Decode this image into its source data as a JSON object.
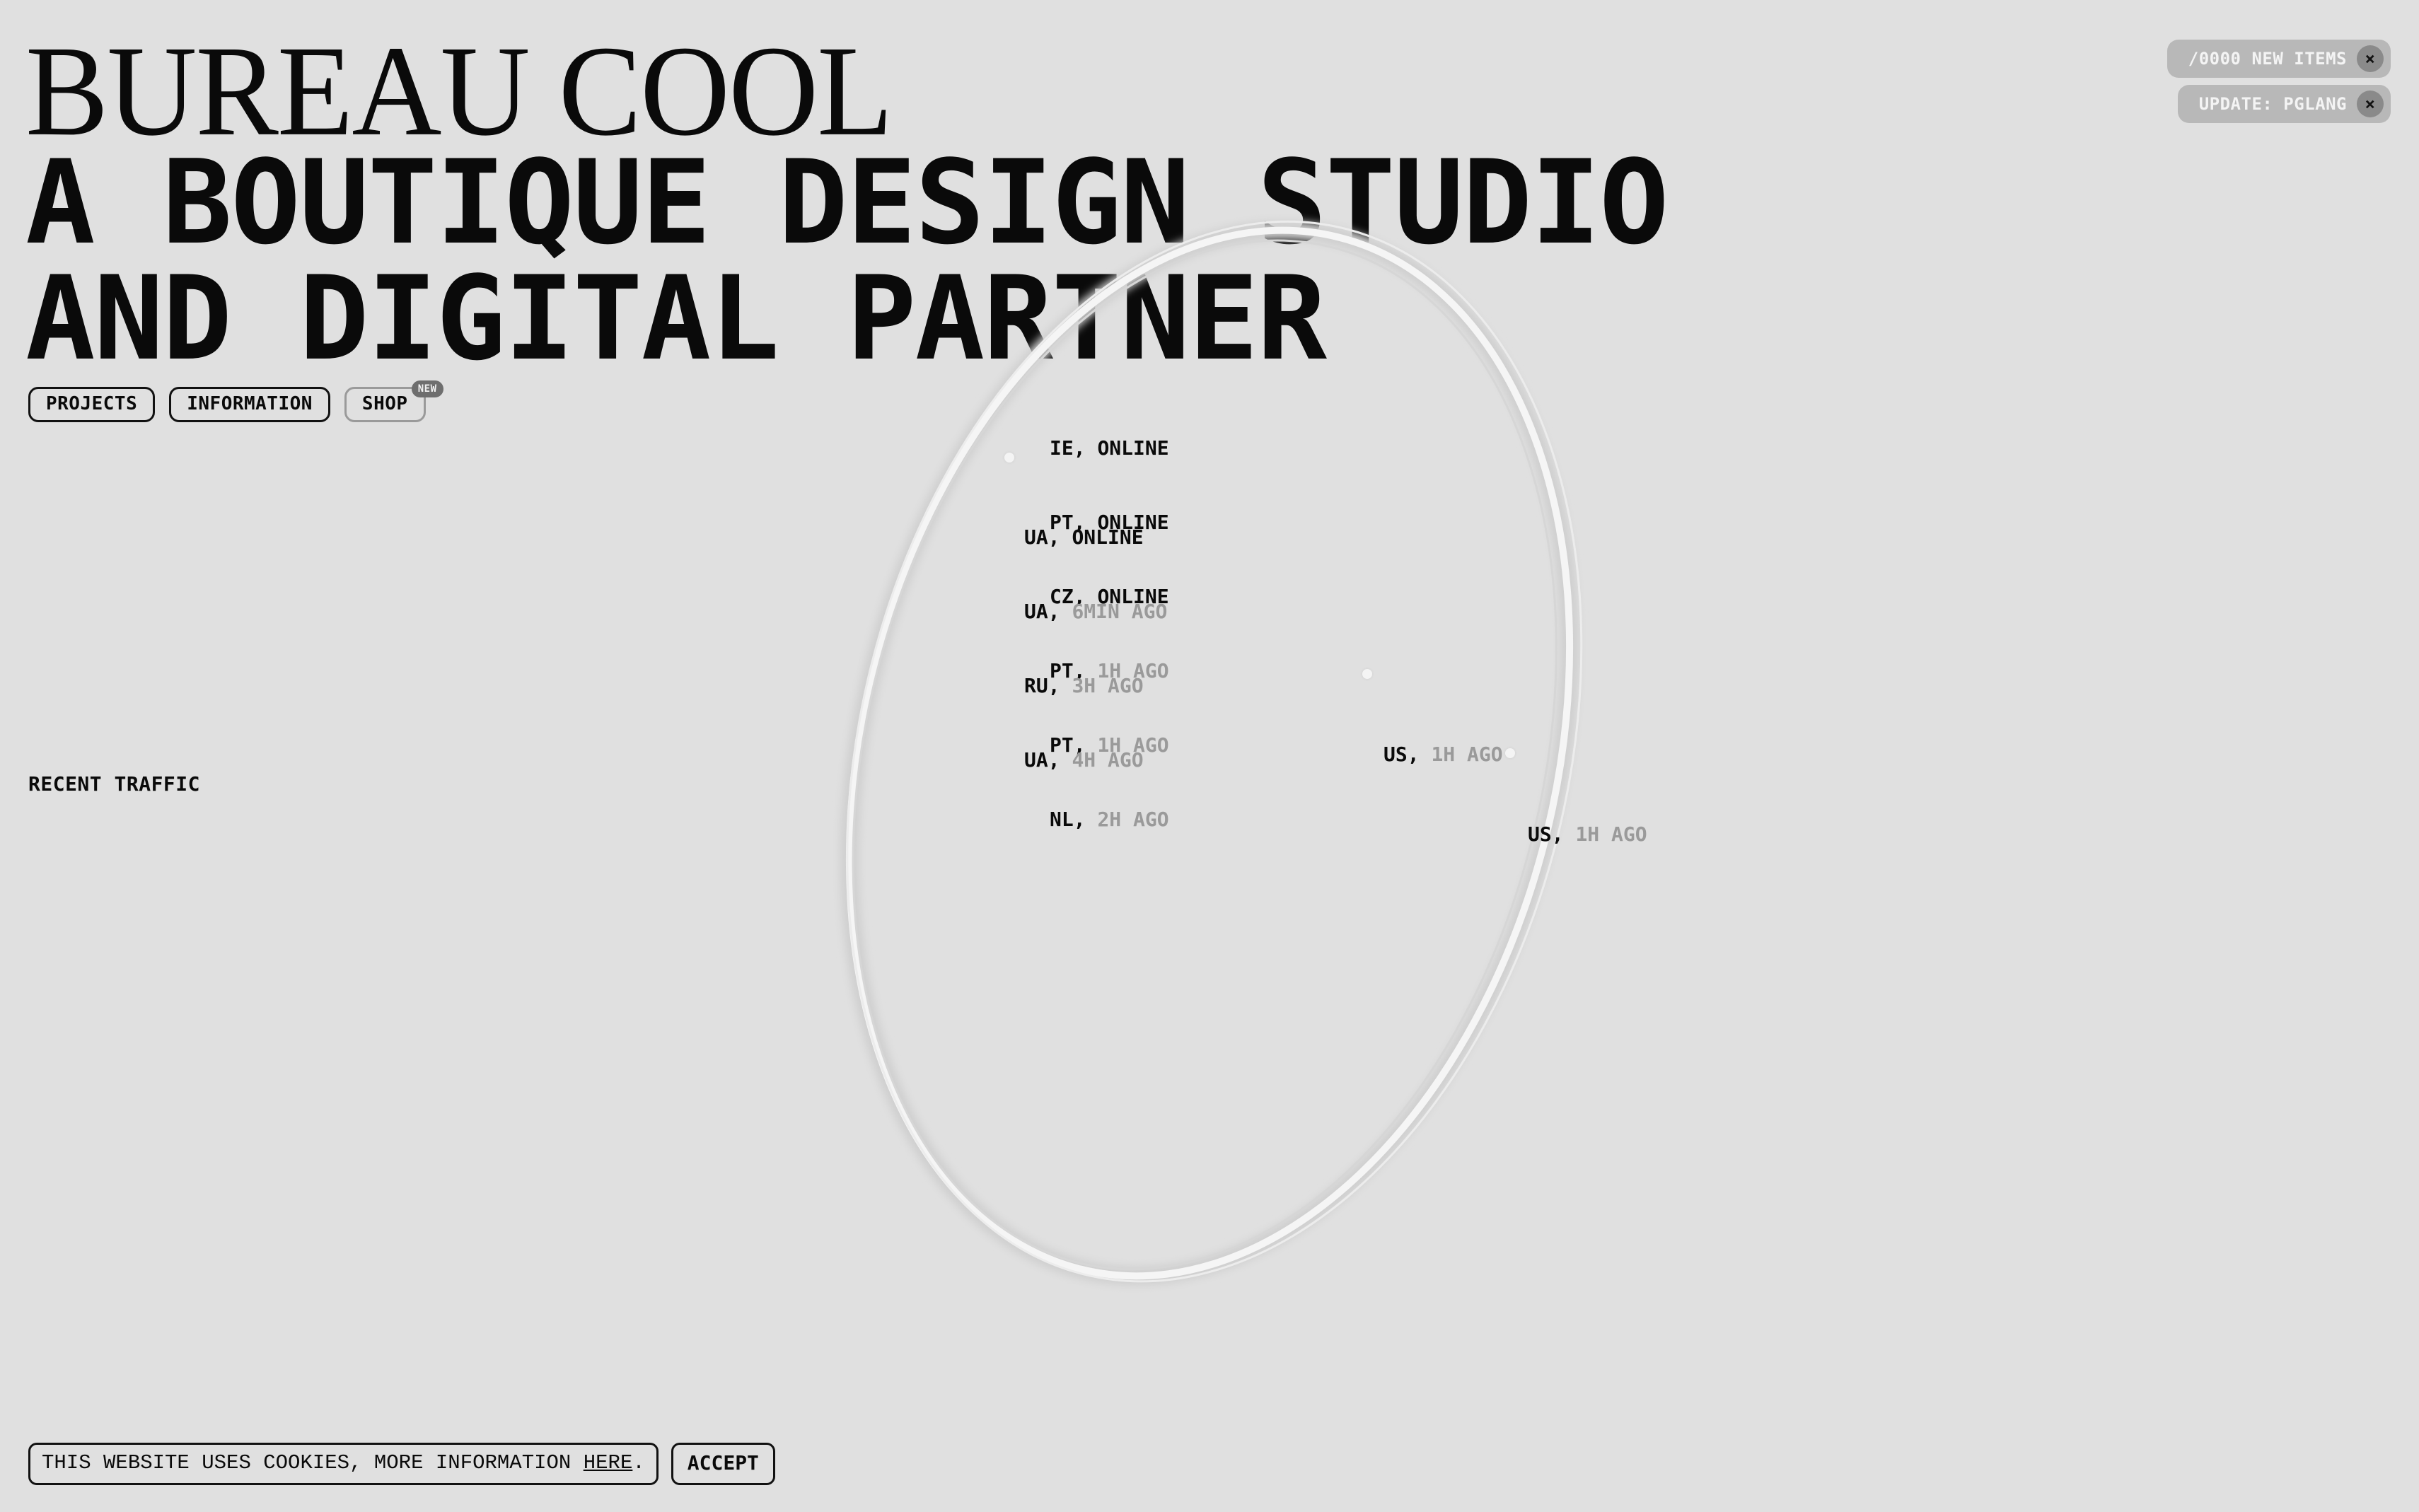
{
  "brand": {
    "name": "BUREAU COOL"
  },
  "tagline": {
    "line1": "A BOUTIQUE DESIGN STUDIO",
    "line2": "AND DIGITAL PARTNER"
  },
  "nav": {
    "projects": "PROJECTS",
    "information": "INFORMATION",
    "shop": "SHOP",
    "shop_badge": "NEW"
  },
  "notifications": [
    {
      "text": "/0000 NEW ITEMS",
      "close": "×"
    },
    {
      "text": "UPDATE: PGLANG",
      "close": "×"
    }
  ],
  "traffic": {
    "label": "RECENT TRAFFIC",
    "group_a": [
      {
        "country": "IE,",
        "time": "ONLINE"
      },
      {
        "country": "PT,",
        "time": "ONLINE"
      },
      {
        "country": "CZ,",
        "time": "ONLINE"
      },
      {
        "country": "PT,",
        "time": "1H AGO"
      },
      {
        "country": "PT,",
        "time": "1H AGO"
      },
      {
        "country": "NL,",
        "time": "2H AGO"
      }
    ],
    "group_b": [
      {
        "country": "UA,",
        "time": "ONLINE"
      },
      {
        "country": "UA,",
        "time": "6MIN AGO"
      },
      {
        "country": "RU,",
        "time": "3H AGO"
      },
      {
        "country": "UA,",
        "time": "4H AGO"
      }
    ],
    "us_1": {
      "country": "US,",
      "time": "1H AGO"
    },
    "us_2": {
      "country": "US,",
      "time": "1H AGO"
    }
  },
  "cookie": {
    "message": "THIS WEBSITE USES COOKIES, MORE INFORMATION ",
    "link": "HERE",
    "period": ".",
    "accept": "ACCEPT"
  },
  "colors": {
    "background": "#e0e0e0",
    "text": "#0a0a0a",
    "muted": "#9a9a9a",
    "notification": "#b8b8b8"
  }
}
